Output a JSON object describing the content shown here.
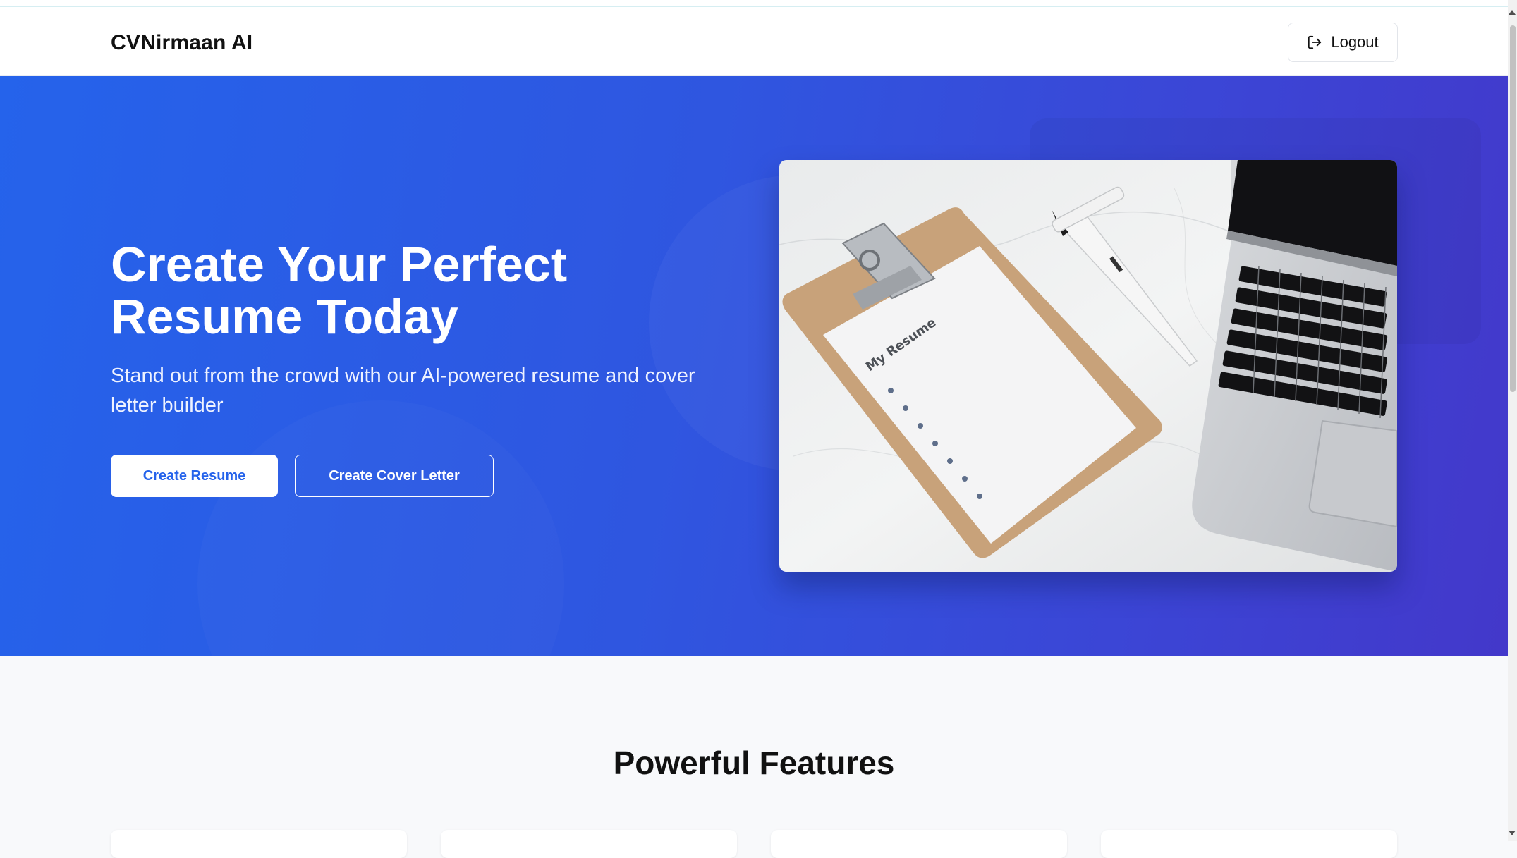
{
  "header": {
    "brand": "CVNirmaan AI",
    "logout_label": "Logout",
    "logout_icon": "logout-icon"
  },
  "hero": {
    "title": "Create Your Perfect Resume Today",
    "subtitle": "Stand out from the crowd with our AI-powered resume and cover letter builder",
    "primary_button": "Create Resume",
    "secondary_button": "Create Cover Letter",
    "image": {
      "paper_title": "My Resume"
    }
  },
  "features": {
    "title": "Powerful Features"
  },
  "colors": {
    "brand_blue": "#2563eb",
    "gradient_end": "#4338ca",
    "section_bg": "#f8f9fb"
  }
}
